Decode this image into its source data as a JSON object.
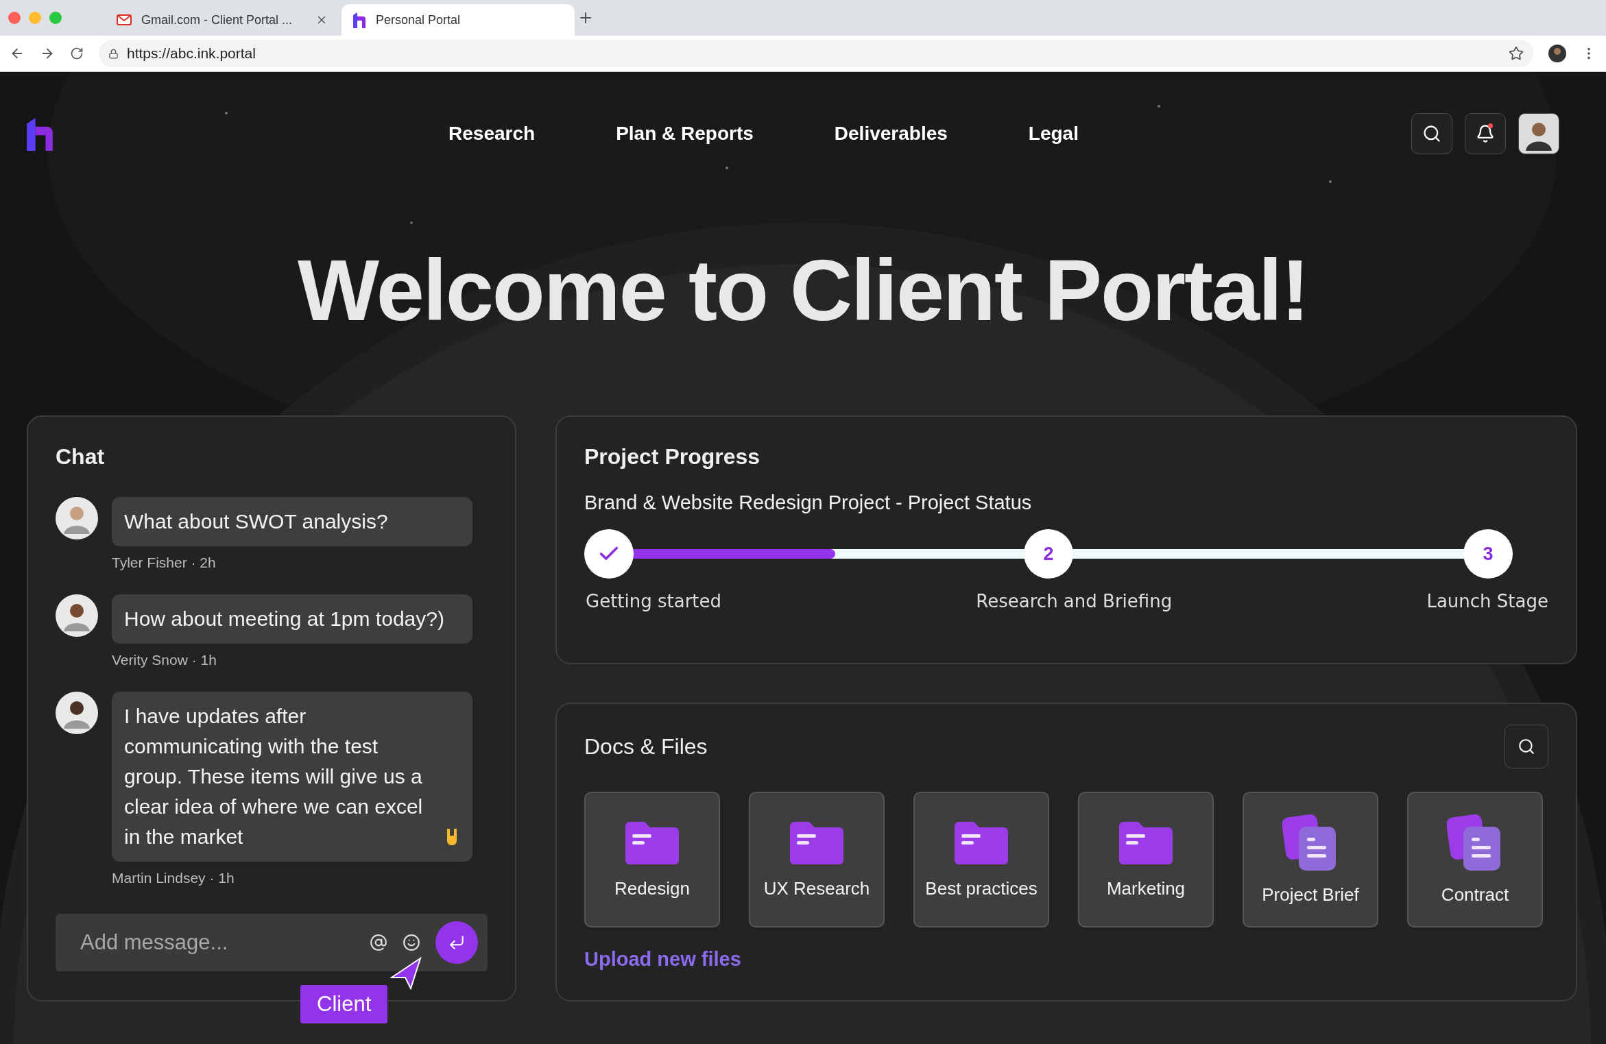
{
  "browser": {
    "tabs": [
      {
        "title": "Gmail.com - Client Portal ...",
        "selected": false,
        "kind": "mail"
      },
      {
        "title": "Personal Portal",
        "selected": true,
        "kind": "portal"
      }
    ],
    "url": "https://abc.ink.portal"
  },
  "nav": {
    "items": [
      {
        "label": "Research"
      },
      {
        "label": "Plan & Reports"
      },
      {
        "label": "Deliverables"
      },
      {
        "label": "Legal"
      }
    ],
    "notifications_unread": true
  },
  "hero": {
    "title": "Welcome to Client Portal!"
  },
  "chat": {
    "title": "Chat",
    "messages": [
      {
        "text": "What about SWOT analysis?",
        "meta": "Tyler Fisher · 2h",
        "reaction": false
      },
      {
        "text": "How about meeting at 1pm today?)",
        "meta": "Verity Snow · 1h",
        "reaction": false
      },
      {
        "text": "I have updates after communicating with the test group. These items will give us a clear idea of where we can excel in the market",
        "meta": "Martin Lindsey · 1h",
        "reaction": true
      }
    ],
    "input": {
      "placeholder": "Add message..."
    },
    "cursor": {
      "label": "Client"
    }
  },
  "progress": {
    "title": "Project Progress",
    "subtitle": "Brand & Website Redesign Project - Project Status",
    "level": 0.27,
    "steps": [
      {
        "label": "Getting started",
        "done": true
      },
      {
        "label": "Research and Briefing",
        "done": false,
        "number": "2"
      },
      {
        "label": "Launch Stage",
        "done": false,
        "number": "3"
      }
    ]
  },
  "docs": {
    "title": "Docs & Files",
    "items": [
      {
        "label": "Redesign",
        "kind": "folder"
      },
      {
        "label": "UX Research",
        "kind": "folder"
      },
      {
        "label": "Best practices",
        "kind": "folder"
      },
      {
        "label": "Marketing",
        "kind": "folder"
      },
      {
        "label": "Project Brief",
        "kind": "document"
      },
      {
        "label": "Contract",
        "kind": "document"
      }
    ],
    "upload_link": "Upload new files"
  }
}
